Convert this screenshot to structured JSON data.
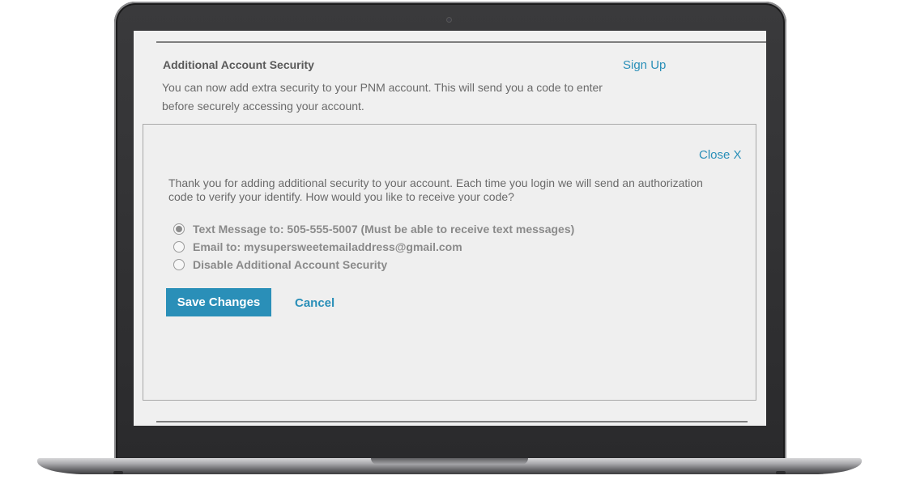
{
  "section": {
    "title": "Additional Account Security",
    "description": "You can now add extra security to your PNM account. This will send you a code to enter before securely accessing your account.",
    "signup_link": "Sign Up"
  },
  "panel": {
    "close_label": "Close X",
    "intro": "Thank you for adding additional security to your account. Each time you login we will send an authorization code to verify your identify. How would you like to receive your code?",
    "options": [
      {
        "label": "Text Message to: 505-555-5007 (Must be able to receive text messages)",
        "selected": true
      },
      {
        "label": "Email to: mysupersweetemailaddress@gmail.com",
        "selected": false
      },
      {
        "label": "Disable Additional Account Security",
        "selected": false
      }
    ],
    "save_label": "Save Changes",
    "cancel_label": "Cancel"
  },
  "colors": {
    "accent": "#2a8fb8",
    "screen_bg": "#f0f0f0",
    "text": "#6a6a6a"
  }
}
